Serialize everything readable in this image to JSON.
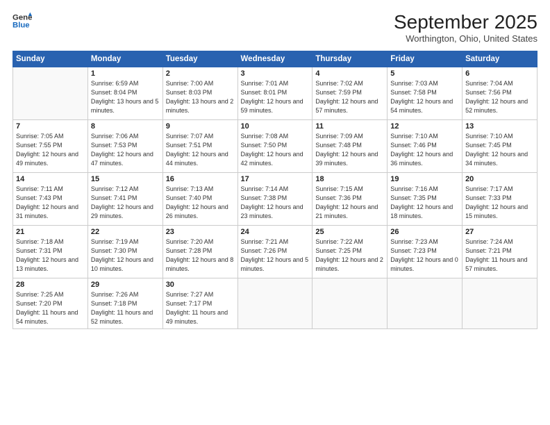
{
  "logo": {
    "line1": "General",
    "line2": "Blue"
  },
  "title": "September 2025",
  "location": "Worthington, Ohio, United States",
  "days_header": [
    "Sunday",
    "Monday",
    "Tuesday",
    "Wednesday",
    "Thursday",
    "Friday",
    "Saturday"
  ],
  "weeks": [
    [
      {
        "num": "",
        "sunrise": "",
        "sunset": "",
        "daylight": ""
      },
      {
        "num": "1",
        "sunrise": "Sunrise: 6:59 AM",
        "sunset": "Sunset: 8:04 PM",
        "daylight": "Daylight: 13 hours and 5 minutes."
      },
      {
        "num": "2",
        "sunrise": "Sunrise: 7:00 AM",
        "sunset": "Sunset: 8:03 PM",
        "daylight": "Daylight: 13 hours and 2 minutes."
      },
      {
        "num": "3",
        "sunrise": "Sunrise: 7:01 AM",
        "sunset": "Sunset: 8:01 PM",
        "daylight": "Daylight: 12 hours and 59 minutes."
      },
      {
        "num": "4",
        "sunrise": "Sunrise: 7:02 AM",
        "sunset": "Sunset: 7:59 PM",
        "daylight": "Daylight: 12 hours and 57 minutes."
      },
      {
        "num": "5",
        "sunrise": "Sunrise: 7:03 AM",
        "sunset": "Sunset: 7:58 PM",
        "daylight": "Daylight: 12 hours and 54 minutes."
      },
      {
        "num": "6",
        "sunrise": "Sunrise: 7:04 AM",
        "sunset": "Sunset: 7:56 PM",
        "daylight": "Daylight: 12 hours and 52 minutes."
      }
    ],
    [
      {
        "num": "7",
        "sunrise": "Sunrise: 7:05 AM",
        "sunset": "Sunset: 7:55 PM",
        "daylight": "Daylight: 12 hours and 49 minutes."
      },
      {
        "num": "8",
        "sunrise": "Sunrise: 7:06 AM",
        "sunset": "Sunset: 7:53 PM",
        "daylight": "Daylight: 12 hours and 47 minutes."
      },
      {
        "num": "9",
        "sunrise": "Sunrise: 7:07 AM",
        "sunset": "Sunset: 7:51 PM",
        "daylight": "Daylight: 12 hours and 44 minutes."
      },
      {
        "num": "10",
        "sunrise": "Sunrise: 7:08 AM",
        "sunset": "Sunset: 7:50 PM",
        "daylight": "Daylight: 12 hours and 42 minutes."
      },
      {
        "num": "11",
        "sunrise": "Sunrise: 7:09 AM",
        "sunset": "Sunset: 7:48 PM",
        "daylight": "Daylight: 12 hours and 39 minutes."
      },
      {
        "num": "12",
        "sunrise": "Sunrise: 7:10 AM",
        "sunset": "Sunset: 7:46 PM",
        "daylight": "Daylight: 12 hours and 36 minutes."
      },
      {
        "num": "13",
        "sunrise": "Sunrise: 7:10 AM",
        "sunset": "Sunset: 7:45 PM",
        "daylight": "Daylight: 12 hours and 34 minutes."
      }
    ],
    [
      {
        "num": "14",
        "sunrise": "Sunrise: 7:11 AM",
        "sunset": "Sunset: 7:43 PM",
        "daylight": "Daylight: 12 hours and 31 minutes."
      },
      {
        "num": "15",
        "sunrise": "Sunrise: 7:12 AM",
        "sunset": "Sunset: 7:41 PM",
        "daylight": "Daylight: 12 hours and 29 minutes."
      },
      {
        "num": "16",
        "sunrise": "Sunrise: 7:13 AM",
        "sunset": "Sunset: 7:40 PM",
        "daylight": "Daylight: 12 hours and 26 minutes."
      },
      {
        "num": "17",
        "sunrise": "Sunrise: 7:14 AM",
        "sunset": "Sunset: 7:38 PM",
        "daylight": "Daylight: 12 hours and 23 minutes."
      },
      {
        "num": "18",
        "sunrise": "Sunrise: 7:15 AM",
        "sunset": "Sunset: 7:36 PM",
        "daylight": "Daylight: 12 hours and 21 minutes."
      },
      {
        "num": "19",
        "sunrise": "Sunrise: 7:16 AM",
        "sunset": "Sunset: 7:35 PM",
        "daylight": "Daylight: 12 hours and 18 minutes."
      },
      {
        "num": "20",
        "sunrise": "Sunrise: 7:17 AM",
        "sunset": "Sunset: 7:33 PM",
        "daylight": "Daylight: 12 hours and 15 minutes."
      }
    ],
    [
      {
        "num": "21",
        "sunrise": "Sunrise: 7:18 AM",
        "sunset": "Sunset: 7:31 PM",
        "daylight": "Daylight: 12 hours and 13 minutes."
      },
      {
        "num": "22",
        "sunrise": "Sunrise: 7:19 AM",
        "sunset": "Sunset: 7:30 PM",
        "daylight": "Daylight: 12 hours and 10 minutes."
      },
      {
        "num": "23",
        "sunrise": "Sunrise: 7:20 AM",
        "sunset": "Sunset: 7:28 PM",
        "daylight": "Daylight: 12 hours and 8 minutes."
      },
      {
        "num": "24",
        "sunrise": "Sunrise: 7:21 AM",
        "sunset": "Sunset: 7:26 PM",
        "daylight": "Daylight: 12 hours and 5 minutes."
      },
      {
        "num": "25",
        "sunrise": "Sunrise: 7:22 AM",
        "sunset": "Sunset: 7:25 PM",
        "daylight": "Daylight: 12 hours and 2 minutes."
      },
      {
        "num": "26",
        "sunrise": "Sunrise: 7:23 AM",
        "sunset": "Sunset: 7:23 PM",
        "daylight": "Daylight: 12 hours and 0 minutes."
      },
      {
        "num": "27",
        "sunrise": "Sunrise: 7:24 AM",
        "sunset": "Sunset: 7:21 PM",
        "daylight": "Daylight: 11 hours and 57 minutes."
      }
    ],
    [
      {
        "num": "28",
        "sunrise": "Sunrise: 7:25 AM",
        "sunset": "Sunset: 7:20 PM",
        "daylight": "Daylight: 11 hours and 54 minutes."
      },
      {
        "num": "29",
        "sunrise": "Sunrise: 7:26 AM",
        "sunset": "Sunset: 7:18 PM",
        "daylight": "Daylight: 11 hours and 52 minutes."
      },
      {
        "num": "30",
        "sunrise": "Sunrise: 7:27 AM",
        "sunset": "Sunset: 7:17 PM",
        "daylight": "Daylight: 11 hours and 49 minutes."
      },
      {
        "num": "",
        "sunrise": "",
        "sunset": "",
        "daylight": ""
      },
      {
        "num": "",
        "sunrise": "",
        "sunset": "",
        "daylight": ""
      },
      {
        "num": "",
        "sunrise": "",
        "sunset": "",
        "daylight": ""
      },
      {
        "num": "",
        "sunrise": "",
        "sunset": "",
        "daylight": ""
      }
    ]
  ]
}
